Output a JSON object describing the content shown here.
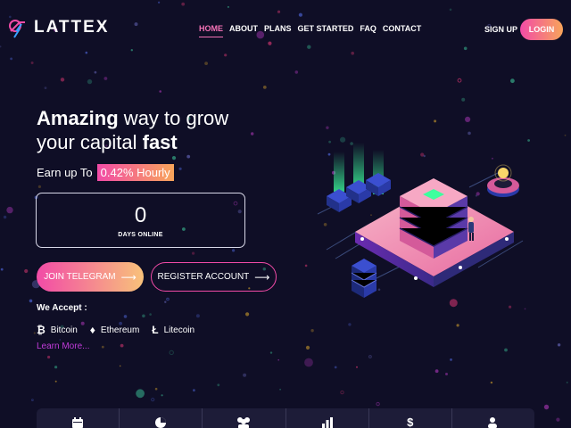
{
  "header": {
    "logo_text": "LATTEX",
    "nav": [
      {
        "label": "HOME",
        "active": true
      },
      {
        "label": "ABOUT",
        "active": false
      },
      {
        "label": "PLANS",
        "active": false
      },
      {
        "label": "GET STARTED",
        "active": false
      },
      {
        "label": "FAQ",
        "active": false
      },
      {
        "label": "CONTACT",
        "active": false
      }
    ],
    "signup_label": "SIGN UP",
    "login_label": "LOGIN"
  },
  "hero": {
    "title_line1_bold": "Amazing",
    "title_line1_rest": " way to grow",
    "title_line2_rest": "your capital ",
    "title_line2_bold": "fast",
    "earn_label": "Earn up To",
    "earn_rate": "0.42% Hourly",
    "counter_value": "0",
    "counter_label": "DAYS ONLINE",
    "telegram_button": "JOIN TELEGRAM",
    "register_button": "REGISTER ACCOUNT",
    "accept_title": "We Accept :",
    "coins": [
      {
        "label": "Bitcoin",
        "icon": "bitcoin-icon",
        "glyph": "₿"
      },
      {
        "label": "Ethereum",
        "icon": "ethereum-icon",
        "glyph": "♦"
      },
      {
        "label": "Litecoin",
        "icon": "litecoin-icon",
        "glyph": "Ł"
      }
    ],
    "learn_more": "Learn More..."
  },
  "bottom_bar": {
    "icons": [
      "calendar-icon",
      "chart-pie-icon",
      "users-icon",
      "bar-chart-icon",
      "dollar-icon",
      "user-icon"
    ]
  },
  "colors": {
    "background": "#0f0e26",
    "accent_pink": "#f24ba7",
    "accent_orange": "#f8a55a",
    "link_purple": "#c03bd9"
  }
}
